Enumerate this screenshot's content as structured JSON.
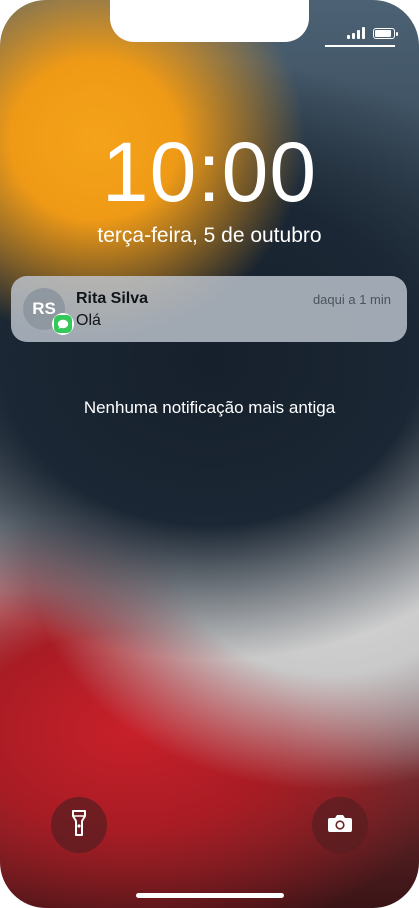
{
  "status_bar": {
    "signal_bars": 4,
    "battery_level": 0.9
  },
  "lock_screen": {
    "time": "10:00",
    "date": "terça-feira, 5 de outubro"
  },
  "notification": {
    "avatar_initials": "RS",
    "sender": "Rita Silva",
    "message": "Olá",
    "relative_time": "daqui a 1 min",
    "app_icon": "messages-icon",
    "app_color": "#35c759"
  },
  "no_older_text": "Nenhuma notificação mais antiga",
  "controls": {
    "left_icon": "flashlight-icon",
    "right_icon": "camera-icon"
  }
}
